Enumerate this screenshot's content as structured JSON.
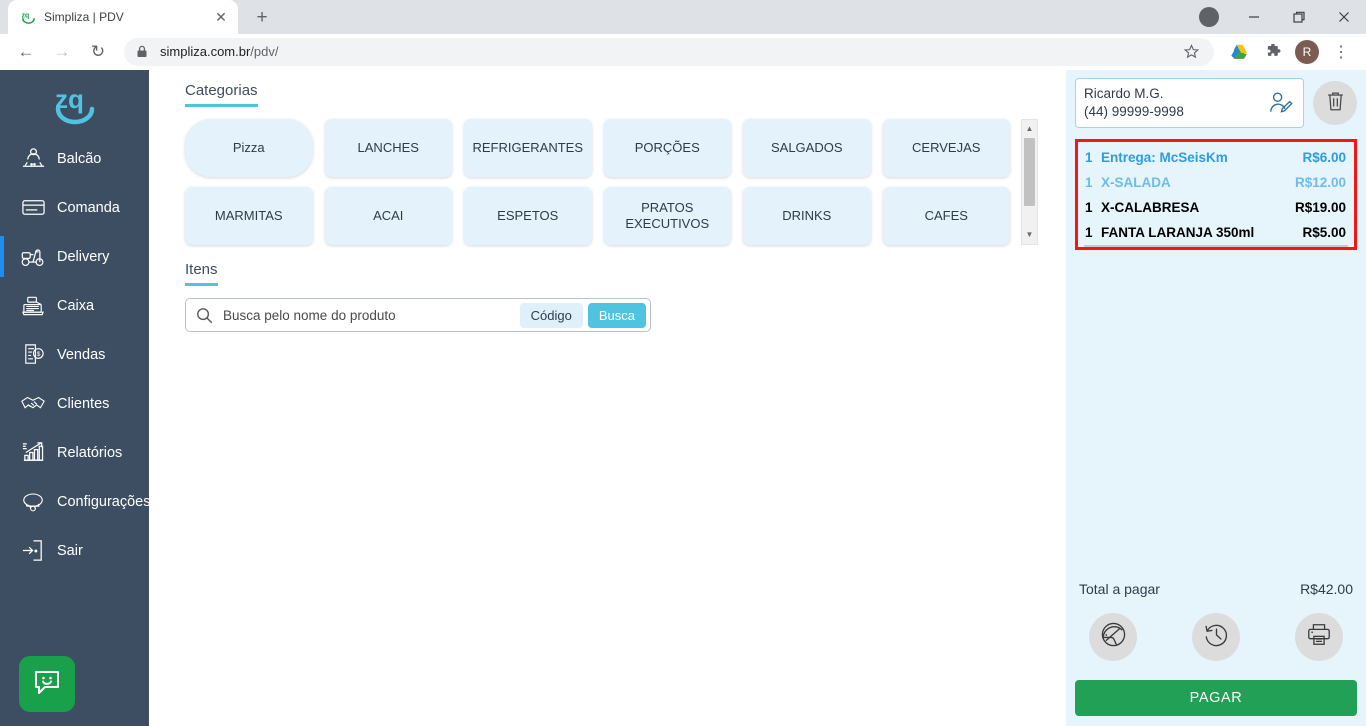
{
  "browser": {
    "tab": {
      "title": "Simpliza | PDV",
      "favicon": "simpliza-logo-icon",
      "close": "✕"
    },
    "new_tab": "+",
    "window_controls": {
      "profile_letter": "",
      "minimize": "—",
      "maximize": "❐",
      "close": "✕"
    },
    "nav": {
      "back": "←",
      "forward": "→",
      "reload": "↻"
    },
    "omnibox": {
      "host": "simpliza.com.br",
      "path": "/pdv/",
      "lock": "lock-icon",
      "star": "☆"
    },
    "toolbar_icons": {
      "drive": "google-drive-icon",
      "extensions": "puzzle-icon",
      "avatar_letter": "R",
      "menu": "⋮"
    }
  },
  "sidebar": {
    "logo": "zq-logo",
    "items": [
      {
        "label": "Balcão",
        "icon": "counter-person-icon",
        "active": false
      },
      {
        "label": "Comanda",
        "icon": "card-icon",
        "active": false
      },
      {
        "label": "Delivery",
        "icon": "scooter-icon",
        "active": true
      },
      {
        "label": "Caixa",
        "icon": "cash-register-icon",
        "active": false
      },
      {
        "label": "Vendas",
        "icon": "receipt-money-icon",
        "active": false
      },
      {
        "label": "Clientes",
        "icon": "handshake-icon",
        "active": false
      },
      {
        "label": "Relatórios",
        "icon": "bar-chart-icon",
        "active": false
      },
      {
        "label": "Configurações",
        "icon": "gear-icon",
        "active": false
      },
      {
        "label": "Sair",
        "icon": "logout-icon",
        "active": false
      }
    ],
    "collapse": "‹",
    "chat_widget": "chat-smiley-icon"
  },
  "main": {
    "categories_title": "Categorias",
    "categories": [
      "Pizza",
      "LANCHES",
      "REFRIGERANTES",
      "PORÇÕES",
      "SALGADOS",
      "CERVEJAS",
      "MARMITAS",
      "ACAI",
      "ESPETOS",
      "PRATOS EXECUTIVOS",
      "DRINKS",
      "CAFES"
    ],
    "selected_category": "Pizza",
    "items_title": "Itens",
    "search": {
      "placeholder": "Busca pelo nome do produto",
      "value": "",
      "icon": "search-icon",
      "codigo_label": "Código",
      "busca_label": "Busca"
    },
    "scrollbar": {
      "up": "▲",
      "down": "▼"
    }
  },
  "order_panel": {
    "customer": {
      "name": "Ricardo M.G.",
      "phone": "(44) 99999-9998",
      "edit_icon": "person-edit-icon"
    },
    "delete_icon": "trash-icon",
    "items": [
      {
        "qty": "1",
        "name": "Entrega: McSeisKm",
        "price": "R$6.00",
        "style": "blue-strong"
      },
      {
        "qty": "1",
        "name": "X-SALADA",
        "price": "R$12.00",
        "style": "blue-light"
      },
      {
        "qty": "1",
        "name": "X-CALABRESA",
        "price": "R$19.00",
        "style": "dark"
      },
      {
        "qty": "1",
        "name": "FANTA LARANJA 350ml",
        "price": "R$5.00",
        "style": "dark"
      }
    ],
    "total_label": "Total a pagar",
    "total_value": "R$42.00",
    "actions": [
      {
        "icon": "helmet-icon"
      },
      {
        "icon": "history-clock-icon"
      },
      {
        "icon": "printer-icon"
      }
    ],
    "pay_label": "PAGAR",
    "highlight_color": "#f41515",
    "pay_color": "#22a055"
  }
}
